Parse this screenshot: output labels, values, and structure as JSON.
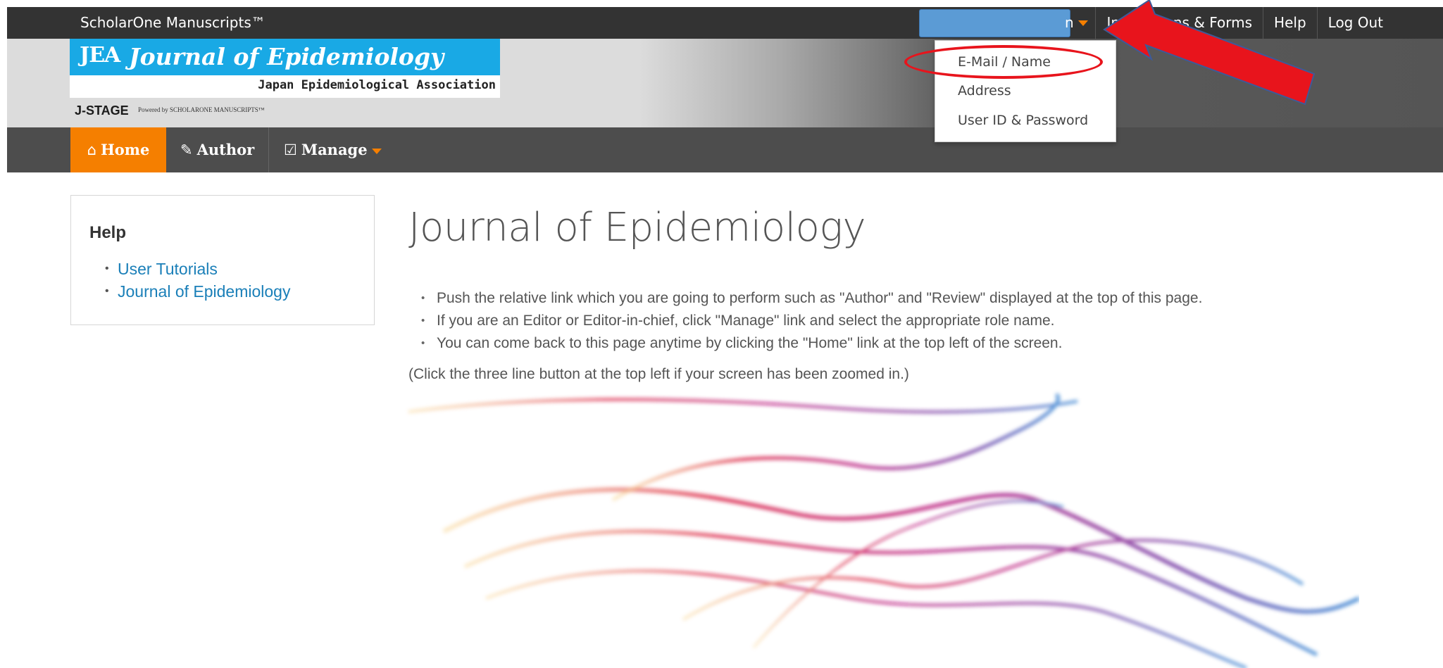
{
  "topbar": {
    "brand": "ScholarOne Manuscripts™",
    "user_menu_tail": "n",
    "links": [
      "Instructions & Forms",
      "Help",
      "Log Out"
    ]
  },
  "header": {
    "logo_abbrev": "JEA",
    "logo_title": "Journal of Epidemiology",
    "logo_association": "Japan Epidemiological Association",
    "jstage": "J-STAGE",
    "powered_by": "Powered by SCHOLARONE MANUSCRIPTS™"
  },
  "nav": {
    "home": "Home",
    "author": "Author",
    "manage": "Manage"
  },
  "dropdown": {
    "items": [
      "E-Mail / Name",
      "Address",
      "User ID & Password"
    ]
  },
  "help": {
    "title": "Help",
    "links": [
      "User Tutorials",
      "Journal of Epidemiology"
    ]
  },
  "main": {
    "title": "Journal of Epidemiology",
    "bullets": [
      "Push the relative link which you are going to perform such as \"Author\" and \"Review\" displayed at the top of this page.",
      "If you are an Editor or Editor-in-chief, click \"Manage\" link and select the appropriate role name.",
      "You can come back to this page anytime by clicking the \"Home\" link at the top left of the screen."
    ],
    "zoom_note": "(Click the three line button at the top left if your screen has been zoomed in.)"
  },
  "colors": {
    "accent_orange": "#f57f00",
    "annotation_red": "#e8141c",
    "link_blue": "#1a7fb8",
    "logo_blue": "#19a9e5"
  }
}
